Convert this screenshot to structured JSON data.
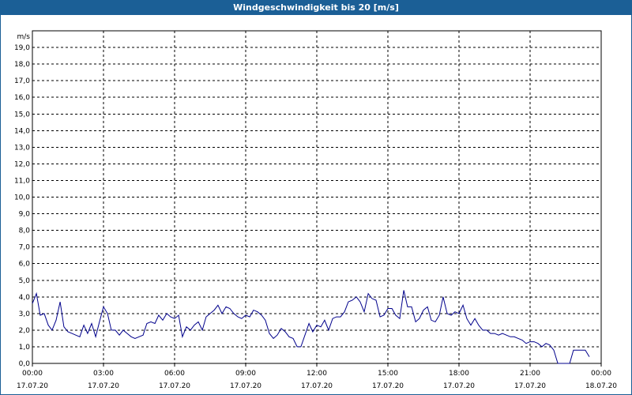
{
  "window": {
    "title": "Windgeschwindigkeit bis 20 [m/s]"
  },
  "chart_data": {
    "type": "line",
    "title": "Windgeschwindigkeit bis 20 [m/s]",
    "ylabel": "m/s",
    "xlabel": "",
    "ylim": [
      0,
      20
    ],
    "xlim": [
      0,
      24
    ],
    "grid": true,
    "line_color": "#00008b",
    "background": "#ffffff",
    "y_ticks": [
      "0,0",
      "1,0",
      "2,0",
      "3,0",
      "4,0",
      "5,0",
      "6,0",
      "7,0",
      "8,0",
      "9,0",
      "10,0",
      "11,0",
      "12,0",
      "13,0",
      "14,0",
      "15,0",
      "16,0",
      "17,0",
      "18,0",
      "19,0"
    ],
    "x_ticks": [
      {
        "time": "00:00",
        "date": "17.07.20",
        "hour": 0
      },
      {
        "time": "03:00",
        "date": "17.07.20",
        "hour": 3
      },
      {
        "time": "06:00",
        "date": "17.07.20",
        "hour": 6
      },
      {
        "time": "09:00",
        "date": "17.07.20",
        "hour": 9
      },
      {
        "time": "12:00",
        "date": "17.07.20",
        "hour": 12
      },
      {
        "time": "15:00",
        "date": "17.07.20",
        "hour": 15
      },
      {
        "time": "18:00",
        "date": "17.07.20",
        "hour": 18
      },
      {
        "time": "21:00",
        "date": "17.07.20",
        "hour": 21
      },
      {
        "time": "00:00",
        "date": "18.07.20",
        "hour": 24
      }
    ],
    "series": [
      {
        "points": [
          [
            0.0,
            3.6
          ],
          [
            0.17,
            4.2
          ],
          [
            0.33,
            2.9
          ],
          [
            0.5,
            3.0
          ],
          [
            0.67,
            2.3
          ],
          [
            0.83,
            2.0
          ],
          [
            1.0,
            2.6
          ],
          [
            1.17,
            3.7
          ],
          [
            1.33,
            2.2
          ],
          [
            1.5,
            1.9
          ],
          [
            1.67,
            1.8
          ],
          [
            1.83,
            1.7
          ],
          [
            2.0,
            1.6
          ],
          [
            2.17,
            2.3
          ],
          [
            2.33,
            1.8
          ],
          [
            2.5,
            2.4
          ],
          [
            2.67,
            1.6
          ],
          [
            2.83,
            2.5
          ],
          [
            3.0,
            3.4
          ],
          [
            3.17,
            3.0
          ],
          [
            3.33,
            2.0
          ],
          [
            3.5,
            2.0
          ],
          [
            3.67,
            1.7
          ],
          [
            3.83,
            2.0
          ],
          [
            4.0,
            1.8
          ],
          [
            4.17,
            1.6
          ],
          [
            4.33,
            1.5
          ],
          [
            4.5,
            1.6
          ],
          [
            4.67,
            1.7
          ],
          [
            4.83,
            2.4
          ],
          [
            5.0,
            2.5
          ],
          [
            5.17,
            2.4
          ],
          [
            5.33,
            2.9
          ],
          [
            5.5,
            2.6
          ],
          [
            5.67,
            3.0
          ],
          [
            5.83,
            2.8
          ],
          [
            6.0,
            2.7
          ],
          [
            6.17,
            2.9
          ],
          [
            6.33,
            1.6
          ],
          [
            6.5,
            2.2
          ],
          [
            6.67,
            2.0
          ],
          [
            6.83,
            2.3
          ],
          [
            7.0,
            2.5
          ],
          [
            7.17,
            2.0
          ],
          [
            7.33,
            2.8
          ],
          [
            7.5,
            3.0
          ],
          [
            7.67,
            3.2
          ],
          [
            7.83,
            3.5
          ],
          [
            8.0,
            3.0
          ],
          [
            8.17,
            3.4
          ],
          [
            8.33,
            3.3
          ],
          [
            8.5,
            3.0
          ],
          [
            8.67,
            2.8
          ],
          [
            8.83,
            2.7
          ],
          [
            9.0,
            2.9
          ],
          [
            9.17,
            2.8
          ],
          [
            9.33,
            3.2
          ],
          [
            9.5,
            3.1
          ],
          [
            9.67,
            2.9
          ],
          [
            9.83,
            2.6
          ],
          [
            10.0,
            1.8
          ],
          [
            10.17,
            1.5
          ],
          [
            10.33,
            1.7
          ],
          [
            10.5,
            2.1
          ],
          [
            10.67,
            1.9
          ],
          [
            10.83,
            1.6
          ],
          [
            11.0,
            1.5
          ],
          [
            11.17,
            1.0
          ],
          [
            11.33,
            1.0
          ],
          [
            11.5,
            1.7
          ],
          [
            11.67,
            2.4
          ],
          [
            11.83,
            1.9
          ],
          [
            12.0,
            2.3
          ],
          [
            12.17,
            2.2
          ],
          [
            12.33,
            2.6
          ],
          [
            12.5,
            2.0
          ],
          [
            12.67,
            2.7
          ],
          [
            12.83,
            2.8
          ],
          [
            13.0,
            2.8
          ],
          [
            13.17,
            3.1
          ],
          [
            13.33,
            3.7
          ],
          [
            13.5,
            3.8
          ],
          [
            13.67,
            4.0
          ],
          [
            13.83,
            3.7
          ],
          [
            14.0,
            3.1
          ],
          [
            14.17,
            4.2
          ],
          [
            14.33,
            3.9
          ],
          [
            14.5,
            3.8
          ],
          [
            14.67,
            2.8
          ],
          [
            14.83,
            2.9
          ],
          [
            15.0,
            3.3
          ],
          [
            15.17,
            3.3
          ],
          [
            15.33,
            2.9
          ],
          [
            15.5,
            2.7
          ],
          [
            15.67,
            4.4
          ],
          [
            15.83,
            3.4
          ],
          [
            16.0,
            3.4
          ],
          [
            16.17,
            2.5
          ],
          [
            16.33,
            2.7
          ],
          [
            16.5,
            3.2
          ],
          [
            16.67,
            3.4
          ],
          [
            16.83,
            2.6
          ],
          [
            17.0,
            2.5
          ],
          [
            17.17,
            2.9
          ],
          [
            17.33,
            4.0
          ],
          [
            17.5,
            3.0
          ],
          [
            17.67,
            2.9
          ],
          [
            17.83,
            3.1
          ],
          [
            18.0,
            3.0
          ],
          [
            18.17,
            3.5
          ],
          [
            18.33,
            2.7
          ],
          [
            18.5,
            2.3
          ],
          [
            18.67,
            2.7
          ],
          [
            18.83,
            2.3
          ],
          [
            19.0,
            2.0
          ],
          [
            19.17,
            2.0
          ],
          [
            19.33,
            1.8
          ],
          [
            19.5,
            1.8
          ],
          [
            19.67,
            1.7
          ],
          [
            19.83,
            1.8
          ],
          [
            20.0,
            1.7
          ],
          [
            20.17,
            1.6
          ],
          [
            20.33,
            1.6
          ],
          [
            20.5,
            1.5
          ],
          [
            20.67,
            1.4
          ],
          [
            20.83,
            1.2
          ],
          [
            21.0,
            1.3
          ],
          [
            21.17,
            1.3
          ],
          [
            21.33,
            1.2
          ],
          [
            21.5,
            1.0
          ],
          [
            21.67,
            1.2
          ],
          [
            21.83,
            1.1
          ],
          [
            22.0,
            0.8
          ],
          [
            22.17,
            0.0
          ],
          [
            22.33,
            0.0
          ],
          [
            22.5,
            0.0
          ],
          [
            22.67,
            0.0
          ],
          [
            22.83,
            0.8
          ],
          [
            23.0,
            0.8
          ],
          [
            23.17,
            0.8
          ],
          [
            23.33,
            0.8
          ],
          [
            23.5,
            0.4
          ]
        ]
      }
    ]
  }
}
